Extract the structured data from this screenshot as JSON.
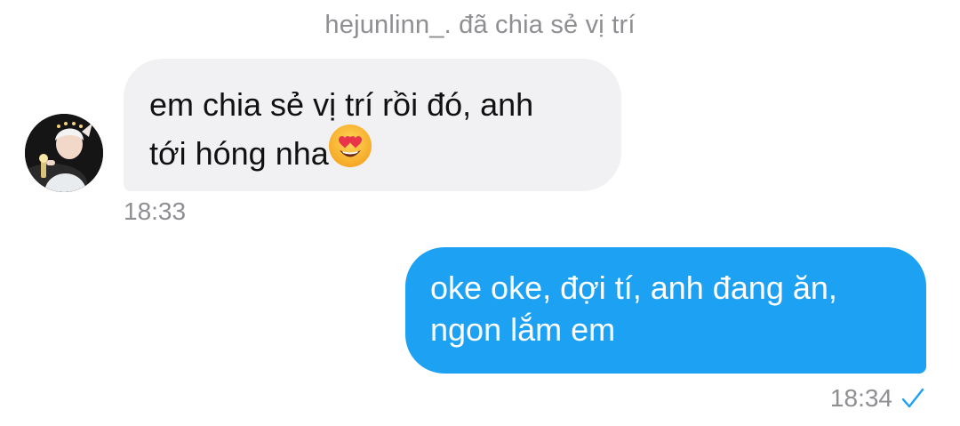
{
  "conversation": {
    "system_note": "hejunlinn_. đã chia sẻ vị trí",
    "messages": [
      {
        "direction": "incoming",
        "line1": "em chia sẻ vị trí rồi đó, anh",
        "line2": "tới hóng nha",
        "emoji": "smiling-face-with-heart-eyes-icon",
        "time": "18:33"
      },
      {
        "direction": "outgoing",
        "line1": "oke oke, đợi tí, anh đang ăn,",
        "line2": "ngon lắm em",
        "time": "18:34",
        "status_icon": "checkmark-icon"
      }
    ]
  },
  "colors": {
    "incoming_bubble": "#f1f1f3",
    "outgoing_bubble": "#1da1f2",
    "timestamp": "#8e8e93",
    "check": "#1da1f2"
  }
}
